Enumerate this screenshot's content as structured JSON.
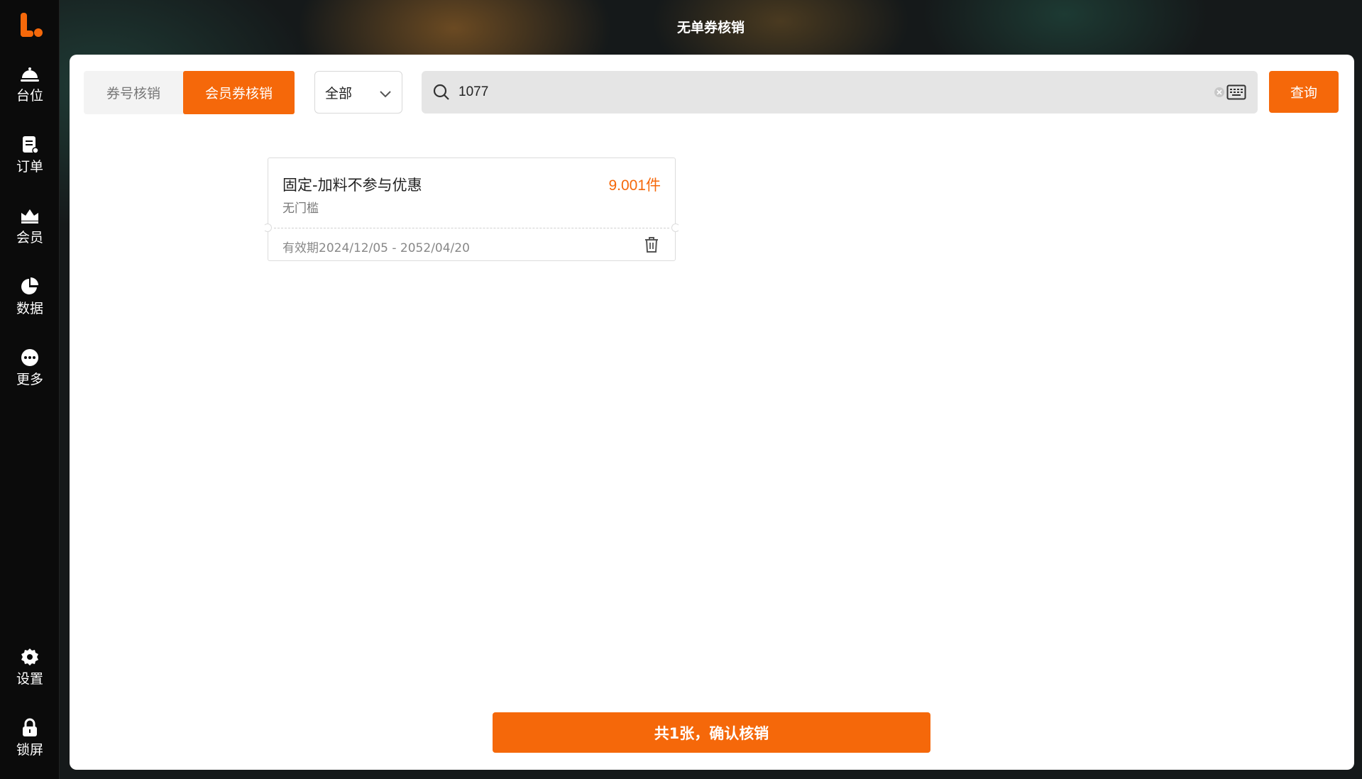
{
  "window": {
    "title": "无单券核销"
  },
  "sidebar": {
    "items": [
      {
        "label": "台位",
        "icon": "table-bell-icon"
      },
      {
        "label": "订单",
        "icon": "order-icon"
      },
      {
        "label": "会员",
        "icon": "member-crown-icon"
      },
      {
        "label": "数据",
        "icon": "pie-chart-icon"
      },
      {
        "label": "更多",
        "icon": "more-icon"
      },
      {
        "label": "设置",
        "icon": "gear-icon"
      },
      {
        "label": "锁屏",
        "icon": "lock-icon"
      }
    ]
  },
  "tabs": {
    "coupon_code": "券号核销",
    "member_coupon": "会员券核销",
    "active": "member_coupon"
  },
  "filter": {
    "selected": "全部"
  },
  "search": {
    "value": "1077"
  },
  "query_button": "查询",
  "coupons": [
    {
      "name": "固定-加料不参与优惠",
      "quantity": "9.001件",
      "threshold": "无门槛",
      "validity": "有效期2024/12/05 - 2052/04/20"
    }
  ],
  "confirm_button": "共1张，确认核销",
  "colors": {
    "accent": "#f5680a",
    "sidebar": "#0b0b0b",
    "panel": "#ffffff"
  }
}
